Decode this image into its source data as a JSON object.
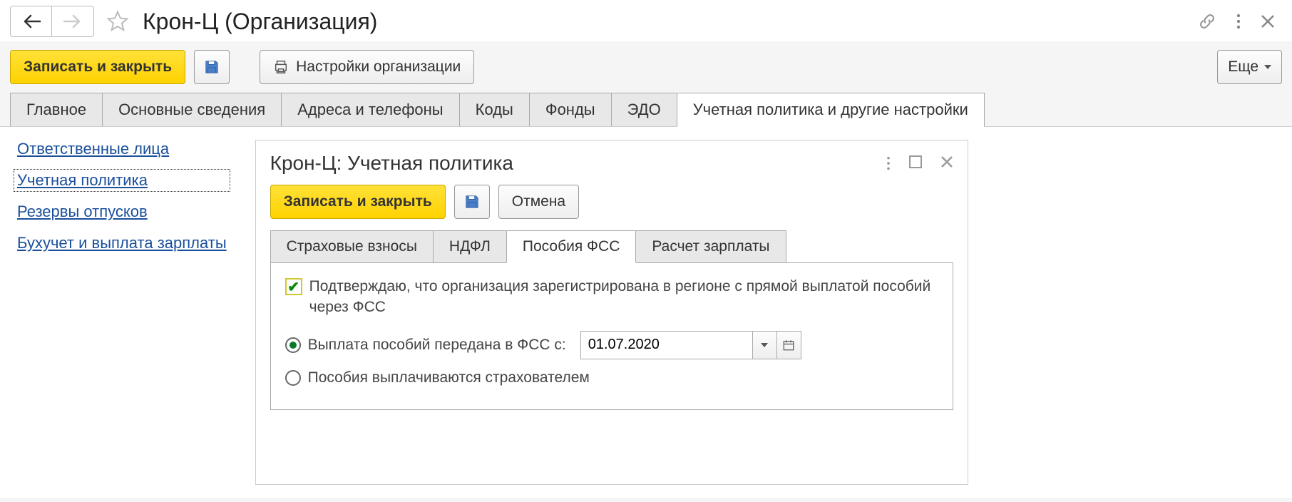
{
  "header": {
    "title": "Крон-Ц (Организация)"
  },
  "toolbar": {
    "save_close": "Записать и закрыть",
    "settings": "Настройки организации",
    "more": "Еще"
  },
  "tabs": [
    {
      "label": "Главное"
    },
    {
      "label": "Основные сведения"
    },
    {
      "label": "Адреса и телефоны"
    },
    {
      "label": "Коды"
    },
    {
      "label": "Фонды"
    },
    {
      "label": "ЭДО"
    },
    {
      "label": "Учетная политика и другие настройки"
    }
  ],
  "sidebar": [
    {
      "label": "Ответственные лица"
    },
    {
      "label": "Учетная политика"
    },
    {
      "label": "Резервы отпусков"
    },
    {
      "label": "Бухучет и выплата зарплаты"
    }
  ],
  "subwindow": {
    "title": "Крон-Ц: Учетная политика",
    "save_close": "Записать и закрыть",
    "cancel": "Отмена",
    "tabs": [
      {
        "label": "Страховые взносы"
      },
      {
        "label": "НДФЛ"
      },
      {
        "label": "Пособия ФСС"
      },
      {
        "label": "Расчет зарплаты"
      }
    ],
    "checkbox_label": "Подтверждаю, что организация зарегистрирована в регионе с прямой выплатой пособий через ФСС",
    "radio1_label": "Выплата пособий передана в ФСС с:",
    "radio2_label": "Пособия выплачиваются страхователем",
    "date_value": "01.07.2020"
  }
}
